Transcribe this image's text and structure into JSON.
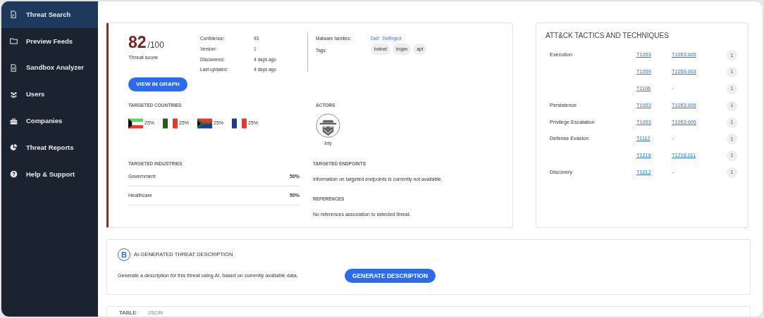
{
  "sidebar": {
    "items": [
      {
        "label": "Threat Search",
        "selected": true
      },
      {
        "label": "Preview Feeds",
        "selected": false
      },
      {
        "label": "Sandbox Analyzer",
        "selected": false
      },
      {
        "label": "Users",
        "selected": false
      },
      {
        "label": "Companies",
        "selected": false
      },
      {
        "label": "Threat Reports",
        "selected": false
      },
      {
        "label": "Help & Support",
        "selected": false
      }
    ]
  },
  "threat": {
    "score": "82",
    "score_max": "/100",
    "score_label": "Threat score",
    "details": [
      {
        "label": "Confidence:",
        "value": "93"
      },
      {
        "label": "Version:",
        "value": "1"
      },
      {
        "label": "Discovered:",
        "value": "4 days ago"
      },
      {
        "label": "Last updated:",
        "value": "4 days ago"
      }
    ],
    "malware_label": "Malware families:",
    "malware_families": [
      "Delf",
      "DelfInject"
    ],
    "tags_label": "Tags:",
    "tags": [
      "botnet",
      "trojan",
      "apt"
    ],
    "view_button": "VIEW IN GRAPH",
    "countries_title": "TARGETED COUNTRIES",
    "countries": [
      {
        "percent": "25%"
      },
      {
        "percent": "25%"
      },
      {
        "percent": "25%"
      },
      {
        "percent": "25%"
      }
    ],
    "actors_title": "ACTORS",
    "actors": [
      {
        "name": "Infy"
      }
    ],
    "industries_title": "TARGETED INDUSTRIES",
    "industries": [
      {
        "name": "Government",
        "percent": "50%"
      },
      {
        "name": "Healthcare",
        "percent": "50%"
      }
    ],
    "endpoints_title": "TARGETED ENDPOINTS",
    "endpoints_text": "Information on targeted endpoints is currently not available.",
    "references_title": "REFERENCES",
    "references_text": "No references association to selected threat."
  },
  "attack": {
    "title": "ATT&CK TACTICS AND TECHNIQUES",
    "rows": [
      {
        "tactic": "Execution",
        "technique": "T1053",
        "sub": "T1053.005",
        "sub_link": true,
        "count": "1"
      },
      {
        "technique": "T1059",
        "sub": "T1059.003",
        "sub_link": true,
        "count": "1"
      },
      {
        "technique": "T1106",
        "sub": "-",
        "sub_link": false,
        "count": "1"
      },
      {
        "tactic": "Persistence",
        "technique": "T1053",
        "sub": "T1053.005",
        "sub_link": true,
        "count": "1"
      },
      {
        "tactic": "Privilege Escalation",
        "technique": "T1053",
        "sub": "T1053.005",
        "sub_link": true,
        "count": "1"
      },
      {
        "tactic": "Defense Evasion",
        "technique": "T1112",
        "sub": "-",
        "sub_link": false,
        "count": "1"
      },
      {
        "technique": "T1218",
        "sub": "T1218.011",
        "sub_link": true,
        "count": "1"
      },
      {
        "tactic": "Discovery",
        "technique": "T1012",
        "sub": "-",
        "sub_link": false,
        "count": "1"
      }
    ]
  },
  "ai": {
    "logo": "B",
    "title": "AI-GENERATED THREAT DESCRIPTION",
    "text": "Generate a description for this threat using AI, based on currently available data.",
    "button": "GENERATE DESCRIPTION"
  },
  "bottom_tabs": [
    {
      "label": "TABLE",
      "selected": true
    },
    {
      "label": "JSON",
      "selected": false
    }
  ]
}
